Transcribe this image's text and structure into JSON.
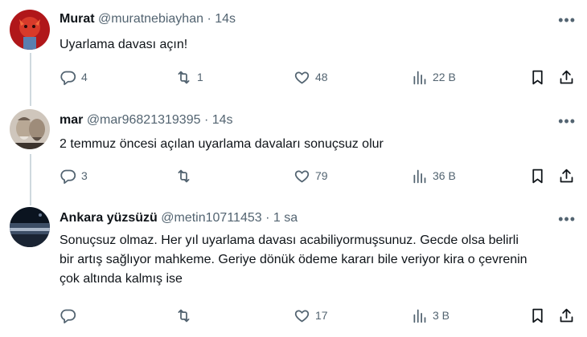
{
  "tweets": [
    {
      "name": "Murat",
      "handle": "@muratnebiayhan",
      "time": "14s",
      "text": "Uyarlama davası açın!",
      "replies": "4",
      "retweets": "1",
      "likes": "48",
      "views": "22 B"
    },
    {
      "name": "mar",
      "handle": "@mar96821319395",
      "time": "14s",
      "text": "2 temmuz öncesi açılan uyarlama davaları sonuçsuz olur",
      "replies": "3",
      "retweets": "",
      "likes": "79",
      "views": "36 B"
    },
    {
      "name": "Ankara yüzsüzü",
      "handle": "@metin10711453",
      "time": "1 sa",
      "text": "Sonuçsuz olmaz. Her yıl uyarlama davası acabiliyormuşsunuz. Gecde olsa belirli bir artış sağlıyor mahkeme. Geriye dönük ödeme kararı bile veriyor kira o çevrenin çok altında kalmış ise",
      "replies": "",
      "retweets": "",
      "likes": "17",
      "views": "3 B"
    }
  ],
  "separator": "·",
  "more_glyph": "•••",
  "icons": [
    "reply-icon",
    "retweet-icon",
    "like-icon",
    "views-icon",
    "bookmark-icon",
    "share-icon",
    "more-icon"
  ],
  "colors": {
    "text": "#0f1419",
    "secondary": "#536471",
    "thread_line": "#cfd9de"
  }
}
